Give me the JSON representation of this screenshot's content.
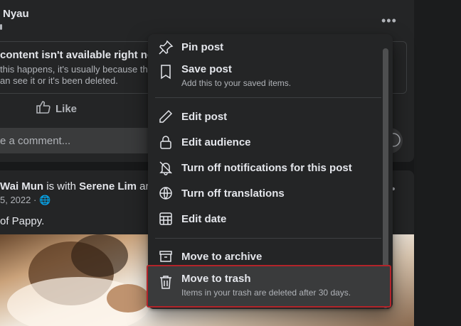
{
  "post1": {
    "author": "Nyau",
    "unavailable_title": "content isn't available right now",
    "unavailable_line1": "this happens, it's usually because the",
    "unavailable_line2": "an see it or it's been deleted.",
    "like_label": "Like",
    "comment_placeholder": "e a comment..."
  },
  "post2": {
    "author_name": "Wai Mun",
    "with_text": " is with ",
    "tagged": "Serene Lim",
    "trailing": " ar",
    "date": "5, 2022 · ",
    "text": "of Pappy."
  },
  "menu": {
    "items": [
      {
        "label": "Pin post",
        "icon": "pin-icon"
      },
      {
        "label": "Save post",
        "sub": "Add this to your saved items.",
        "icon": "bookmark-icon"
      },
      {
        "label": "Edit post",
        "icon": "pencil-icon"
      },
      {
        "label": "Edit audience",
        "icon": "lock-icon"
      },
      {
        "label": "Turn off notifications for this post",
        "icon": "bell-off-icon"
      },
      {
        "label": "Turn off translations",
        "icon": "globe-icon"
      },
      {
        "label": "Edit date",
        "icon": "calendar-icon"
      },
      {
        "label": "Move to archive",
        "icon": "archive-icon"
      },
      {
        "label": "Move to trash",
        "sub": "Items in your trash are deleted after 30 days.",
        "icon": "trash-icon"
      }
    ]
  },
  "colors": {
    "background": "#18191a",
    "card": "#242526",
    "highlight_border": "#b3242a"
  }
}
